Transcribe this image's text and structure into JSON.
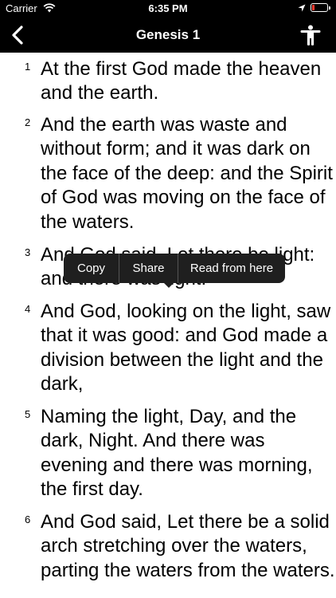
{
  "status_bar": {
    "carrier": "Carrier",
    "time": "6:35 PM"
  },
  "nav": {
    "title": "Genesis 1"
  },
  "verses": [
    {
      "num": "1",
      "text": "At the first God made the heaven and the earth."
    },
    {
      "num": "2",
      "text": "And the earth was waste and without form; and it was dark on the face of the deep: and the Spirit of God was moving on the face of the waters."
    },
    {
      "num": "3",
      "text": "And God said, Let there be light: and there was light."
    },
    {
      "num": "4",
      "text": "And God, looking on the light, saw that it was good: and God made a division between the light and the dark,"
    },
    {
      "num": "5",
      "text": "Naming the light, Day, and the dark, Night. And there was evening and there was morning, the first day."
    },
    {
      "num": "6",
      "text": "And God said, Let there be a solid arch stretching over the waters, parting the waters from the waters."
    }
  ],
  "context_menu": {
    "copy": "Copy",
    "share": "Share",
    "read_from_here": "Read from here"
  }
}
